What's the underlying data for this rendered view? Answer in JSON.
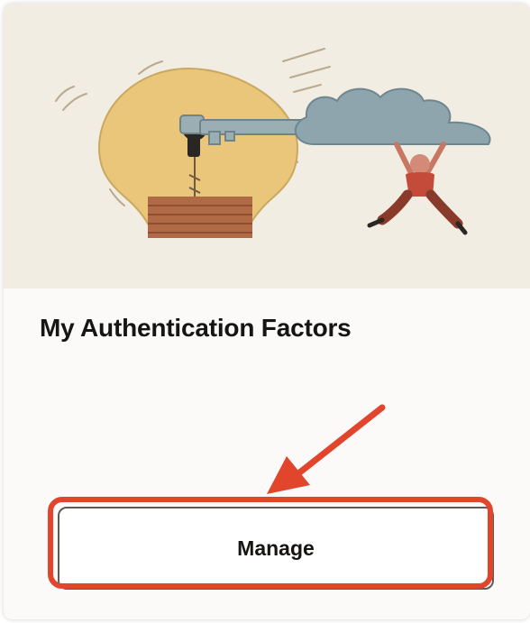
{
  "card": {
    "title": "My Authentication Factors",
    "manage_label": "Manage"
  },
  "illustration": {
    "subject": "lightbulb-key-cloud-illustration"
  },
  "annotation": {
    "arrow_icon": "arrow-icon",
    "highlight_color": "#e1452b"
  },
  "colors": {
    "card_background": "#fbfaf8",
    "illustration_background": "#f1ede2",
    "title_text": "#161513",
    "button_border": "#5e5b56"
  }
}
